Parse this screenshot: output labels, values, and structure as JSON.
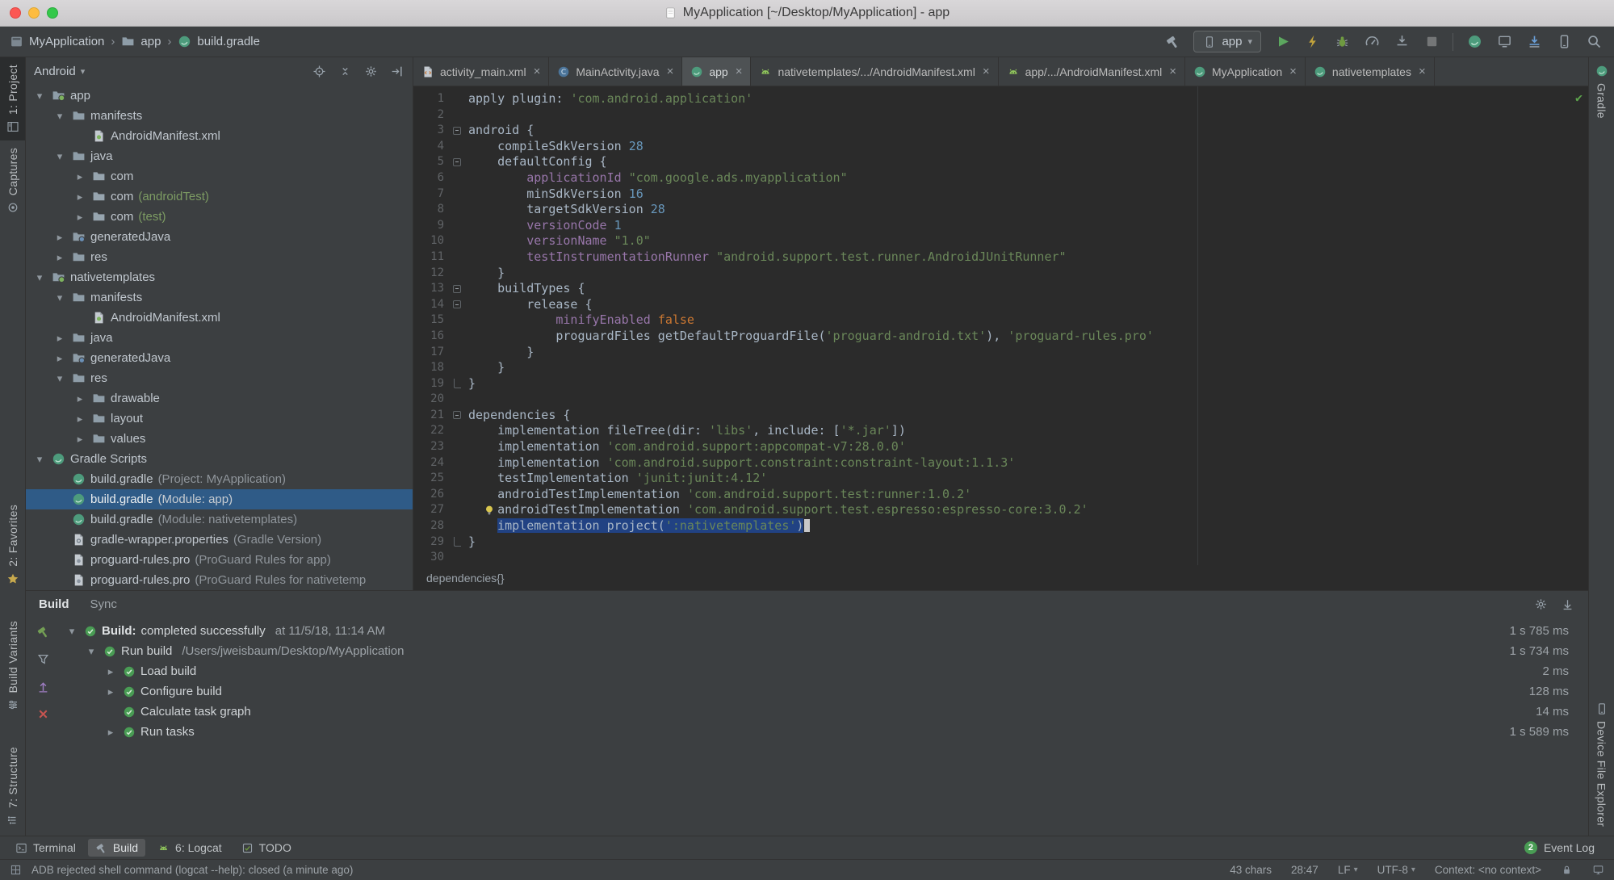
{
  "titlebar": {
    "title": "MyApplication [~/Desktop/MyApplication] - app"
  },
  "toolbar": {
    "breadcrumbs": [
      {
        "icon": "project",
        "label": "MyApplication"
      },
      {
        "icon": "folder",
        "label": "app"
      },
      {
        "icon": "gradle-file",
        "label": "build.gradle"
      }
    ],
    "run_config_label": "app"
  },
  "left_strip": {
    "top": [
      {
        "icon": "panel-left",
        "label": "1: Project",
        "active": true
      },
      {
        "icon": "captures",
        "label": "Captures",
        "active": false
      }
    ],
    "bottom": [
      {
        "icon": "star",
        "label": "2: Favorites",
        "active": false
      },
      {
        "icon": "variants",
        "label": "Build Variants",
        "active": false
      },
      {
        "icon": "structure",
        "label": "7: Structure",
        "active": false
      }
    ]
  },
  "right_strip": {
    "top": [
      {
        "icon": "gradle-file",
        "label": "Gradle",
        "active": false
      }
    ],
    "bottom": [
      {
        "icon": "phone",
        "label": "Device File Explorer",
        "active": false
      }
    ]
  },
  "project_panel": {
    "view_selector": "Android",
    "tree": [
      {
        "indent": 0,
        "arrow": "down",
        "icon": "module",
        "label": "app",
        "suffix": ""
      },
      {
        "indent": 1,
        "arrow": "down",
        "icon": "folder",
        "label": "manifests",
        "suffix": ""
      },
      {
        "indent": 2,
        "arrow": "none",
        "icon": "manifest",
        "label": "AndroidManifest.xml",
        "suffix": ""
      },
      {
        "indent": 1,
        "arrow": "down",
        "icon": "folder",
        "label": "java",
        "suffix": ""
      },
      {
        "indent": 2,
        "arrow": "right",
        "icon": "package",
        "label": "com",
        "suffix": ""
      },
      {
        "indent": 2,
        "arrow": "right",
        "icon": "package",
        "label": "com",
        "suffix": "(androidTest)",
        "suffix_kind": "test"
      },
      {
        "indent": 2,
        "arrow": "right",
        "icon": "package",
        "label": "com",
        "suffix": "(test)",
        "suffix_kind": "test"
      },
      {
        "indent": 1,
        "arrow": "right",
        "icon": "gen-folder",
        "label": "generatedJava",
        "suffix": ""
      },
      {
        "indent": 1,
        "arrow": "right",
        "icon": "folder",
        "label": "res",
        "suffix": ""
      },
      {
        "indent": 0,
        "arrow": "down",
        "icon": "module",
        "label": "nativetemplates",
        "suffix": ""
      },
      {
        "indent": 1,
        "arrow": "down",
        "icon": "folder",
        "label": "manifests",
        "suffix": ""
      },
      {
        "indent": 2,
        "arrow": "none",
        "icon": "manifest",
        "label": "AndroidManifest.xml",
        "suffix": ""
      },
      {
        "indent": 1,
        "arrow": "right",
        "icon": "folder",
        "label": "java",
        "suffix": ""
      },
      {
        "indent": 1,
        "arrow": "right",
        "icon": "gen-folder",
        "label": "generatedJava",
        "suffix": ""
      },
      {
        "indent": 1,
        "arrow": "down",
        "icon": "folder",
        "label": "res",
        "suffix": ""
      },
      {
        "indent": 2,
        "arrow": "right",
        "icon": "folder",
        "label": "drawable",
        "suffix": ""
      },
      {
        "indent": 2,
        "arrow": "right",
        "icon": "folder",
        "label": "layout",
        "suffix": ""
      },
      {
        "indent": 2,
        "arrow": "right",
        "icon": "folder",
        "label": "values",
        "suffix": ""
      },
      {
        "indent": 0,
        "arrow": "down",
        "icon": "gradle-file",
        "label": "Gradle Scripts",
        "suffix": ""
      },
      {
        "indent": 1,
        "arrow": "none",
        "icon": "gradle-file",
        "label": "build.gradle",
        "suffix": "(Project: MyApplication)"
      },
      {
        "indent": 1,
        "arrow": "none",
        "icon": "gradle-file",
        "label": "build.gradle",
        "suffix": "(Module: app)",
        "selected": true
      },
      {
        "indent": 1,
        "arrow": "none",
        "icon": "gradle-file",
        "label": "build.gradle",
        "suffix": "(Module: nativetemplates)"
      },
      {
        "indent": 1,
        "arrow": "none",
        "icon": "properties",
        "label": "gradle-wrapper.properties",
        "suffix": "(Gradle Version)"
      },
      {
        "indent": 1,
        "arrow": "none",
        "icon": "proguard",
        "label": "proguard-rules.pro",
        "suffix": "(ProGuard Rules for app)"
      },
      {
        "indent": 1,
        "arrow": "none",
        "icon": "proguard",
        "label": "proguard-rules.pro",
        "suffix": "(ProGuard Rules for nativetemp"
      }
    ]
  },
  "editor": {
    "tabs": [
      {
        "icon": "xml-file",
        "label": "activity_main.xml",
        "active": false
      },
      {
        "icon": "java-class",
        "label": "MainActivity.java",
        "active": false
      },
      {
        "icon": "gradle-file",
        "label": "app",
        "active": true
      },
      {
        "icon": "android",
        "label": "nativetemplates/.../AndroidManifest.xml",
        "active": false
      },
      {
        "icon": "android",
        "label": "app/.../AndroidManifest.xml",
        "active": false
      },
      {
        "icon": "gradle-file",
        "label": "MyApplication",
        "active": false
      },
      {
        "icon": "gradle-file",
        "label": "nativetemplates",
        "active": false
      }
    ],
    "code": {
      "breadcrumb": "dependencies{}",
      "lines": [
        {
          "n": 1,
          "t": [
            [
              "p",
              "apply plugin: "
            ],
            [
              "s",
              "'com.android.application'"
            ]
          ]
        },
        {
          "n": 2,
          "t": []
        },
        {
          "n": 3,
          "t": [
            [
              "p",
              "android {"
            ]
          ],
          "fold": "start"
        },
        {
          "n": 4,
          "t": [
            [
              "p",
              "    compileSdkVersion "
            ],
            [
              "n",
              "28"
            ]
          ]
        },
        {
          "n": 5,
          "t": [
            [
              "p",
              "    defaultConfig {"
            ]
          ],
          "fold": "start"
        },
        {
          "n": 6,
          "t": [
            [
              "p",
              "        "
            ],
            [
              "f",
              "applicationId"
            ],
            [
              "p",
              " "
            ],
            [
              "s",
              "\"com.google.ads.myapplication\""
            ]
          ]
        },
        {
          "n": 7,
          "t": [
            [
              "p",
              "        minSdkVersion "
            ],
            [
              "n",
              "16"
            ]
          ]
        },
        {
          "n": 8,
          "t": [
            [
              "p",
              "        targetSdkVersion "
            ],
            [
              "n",
              "28"
            ]
          ]
        },
        {
          "n": 9,
          "t": [
            [
              "p",
              "        "
            ],
            [
              "f",
              "versionCode"
            ],
            [
              "p",
              " "
            ],
            [
              "n",
              "1"
            ]
          ]
        },
        {
          "n": 10,
          "t": [
            [
              "p",
              "        "
            ],
            [
              "f",
              "versionName"
            ],
            [
              "p",
              " "
            ],
            [
              "s",
              "\"1.0\""
            ]
          ]
        },
        {
          "n": 11,
          "t": [
            [
              "p",
              "        "
            ],
            [
              "f",
              "testInstrumentationRunner"
            ],
            [
              "p",
              " "
            ],
            [
              "s",
              "\"android.support.test.runner.AndroidJUnitRunner\""
            ]
          ]
        },
        {
          "n": 12,
          "t": [
            [
              "p",
              "    }"
            ]
          ]
        },
        {
          "n": 13,
          "t": [
            [
              "p",
              "    buildTypes {"
            ]
          ],
          "fold": "start"
        },
        {
          "n": 14,
          "t": [
            [
              "p",
              "        release {"
            ]
          ],
          "fold": "start"
        },
        {
          "n": 15,
          "t": [
            [
              "p",
              "            "
            ],
            [
              "f",
              "minifyEnabled"
            ],
            [
              "p",
              " "
            ],
            [
              "k",
              "false"
            ]
          ]
        },
        {
          "n": 16,
          "t": [
            [
              "p",
              "            proguardFiles getDefaultProguardFile("
            ],
            [
              "s",
              "'proguard-android.txt'"
            ],
            [
              "p",
              "), "
            ],
            [
              "s",
              "'proguard-rules.pro'"
            ]
          ]
        },
        {
          "n": 17,
          "t": [
            [
              "p",
              "        }"
            ]
          ]
        },
        {
          "n": 18,
          "t": [
            [
              "p",
              "    }"
            ]
          ]
        },
        {
          "n": 19,
          "t": [
            [
              "p",
              "}"
            ]
          ],
          "fold": "end"
        },
        {
          "n": 20,
          "t": []
        },
        {
          "n": 21,
          "t": [
            [
              "p",
              "dependencies {"
            ]
          ],
          "fold": "start"
        },
        {
          "n": 22,
          "t": [
            [
              "p",
              "    implementation fileTree(dir: "
            ],
            [
              "s",
              "'libs'"
            ],
            [
              "p",
              ", include: ["
            ],
            [
              "s",
              "'*.jar'"
            ],
            [
              "p",
              "])"
            ]
          ]
        },
        {
          "n": 23,
          "t": [
            [
              "p",
              "    implementation "
            ],
            [
              "s",
              "'com.android.support:appcompat-v7:28.0.0'"
            ]
          ]
        },
        {
          "n": 24,
          "t": [
            [
              "p",
              "    implementation "
            ],
            [
              "s",
              "'com.android.support.constraint:constraint-layout:1.1.3'"
            ]
          ]
        },
        {
          "n": 25,
          "t": [
            [
              "p",
              "    testImplementation "
            ],
            [
              "s",
              "'junit:junit:4.12'"
            ]
          ]
        },
        {
          "n": 26,
          "t": [
            [
              "p",
              "    androidTestImplementation "
            ],
            [
              "s",
              "'com.android.support.test:runner:1.0.2'"
            ]
          ]
        },
        {
          "n": 27,
          "t": [
            [
              "p",
              "    androidTestImplementation "
            ],
            [
              "s",
              "'com.android.support.test.espresso:espresso-core:3.0.2'"
            ]
          ],
          "bulb": true
        },
        {
          "n": 28,
          "t": [
            [
              "p",
              "    "
            ],
            [
              "p",
              "implementation project(",
              1
            ],
            [
              "s",
              "':nativetemplates'",
              1
            ],
            [
              "p",
              ")",
              1
            ]
          ],
          "caret": true
        },
        {
          "n": 29,
          "t": [
            [
              "p",
              "}"
            ]
          ],
          "fold": "end"
        },
        {
          "n": 30,
          "t": []
        }
      ]
    }
  },
  "build_panel": {
    "tabs": [
      {
        "label": "Build",
        "active": true
      },
      {
        "label": "Sync",
        "active": false
      }
    ],
    "rows": [
      {
        "indent": 0,
        "arrow": "down",
        "strong": "Build:",
        "label": "completed successfully",
        "detail": "at 11/5/18, 11:14 AM",
        "time": "1 s 785 ms"
      },
      {
        "indent": 1,
        "arrow": "down",
        "strong": "",
        "label": "Run build",
        "detail": "/Users/jweisbaum/Desktop/MyApplication",
        "time": "1 s 734 ms"
      },
      {
        "indent": 2,
        "arrow": "right",
        "strong": "",
        "label": "Load build",
        "detail": "",
        "time": "2 ms"
      },
      {
        "indent": 2,
        "arrow": "right",
        "strong": "",
        "label": "Configure build",
        "detail": "",
        "time": "128 ms"
      },
      {
        "indent": 2,
        "arrow": "none",
        "strong": "",
        "label": "Calculate task graph",
        "detail": "",
        "time": "14 ms"
      },
      {
        "indent": 2,
        "arrow": "right",
        "strong": "",
        "label": "Run tasks",
        "detail": "",
        "time": "1 s 589 ms"
      }
    ]
  },
  "bottom_bar": {
    "items": [
      {
        "icon": "terminal",
        "label": "Terminal",
        "active": false
      },
      {
        "icon": "hammer",
        "label": "Build",
        "active": true
      },
      {
        "icon": "android",
        "label": "6: Logcat",
        "active": false
      },
      {
        "icon": "todo",
        "label": "TODO",
        "active": false
      }
    ],
    "event_log": {
      "badge": "2",
      "label": "Event Log"
    }
  },
  "status_bar": {
    "message": "ADB rejected shell command (logcat --help): closed (a minute ago)",
    "selection_info": "43 chars",
    "caret_position": "28:47",
    "line_ending": "LF",
    "encoding": "UTF-8",
    "context": "Context: <no context>"
  },
  "colors": {
    "editor_bg": "#2b2b2b",
    "panel_bg": "#3c3f41",
    "selection_blue": "#214283",
    "tree_selection": "#2f5b87",
    "string_green": "#6a8759",
    "keyword_orange": "#cc7832",
    "number_blue": "#6897bb",
    "field_purple": "#9876aa",
    "run_green": "#5ca75f",
    "success_green": "#499c54",
    "error_red": "#c75450"
  }
}
